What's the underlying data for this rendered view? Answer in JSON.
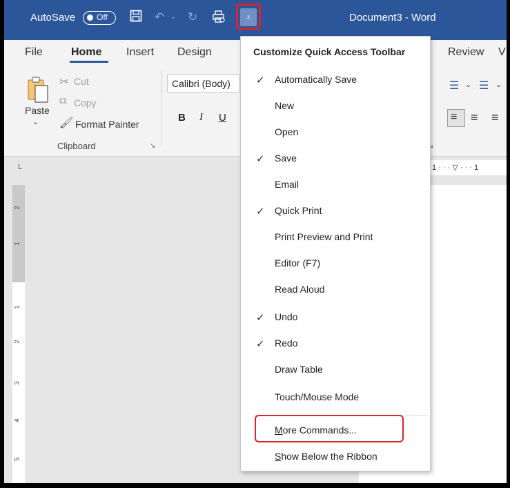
{
  "titlebar": {
    "autosave_label": "AutoSave",
    "autosave_state": "Off",
    "document_title": "Document3  -  Word",
    "colors": {
      "accent": "#2b579a",
      "highlight": "#d9232d"
    }
  },
  "tabs": [
    "File",
    "Home",
    "Insert",
    "Design",
    "Review",
    "V"
  ],
  "ribbon": {
    "paste": "Paste",
    "cut": "Cut",
    "copy": "Copy",
    "format_painter": "Format Painter",
    "clipboard_group": "Clipboard",
    "font_name": "Calibri (Body)",
    "bold": "B",
    "italic": "I",
    "underline": "U"
  },
  "ruler": {
    "corner": "L",
    "horizontal_text": "1 · · · ▽ · · · 1",
    "vertical_ticks": [
      "2",
      "1",
      "1",
      "2",
      "3",
      "4",
      "5"
    ]
  },
  "menu": {
    "title": "Customize Quick Access Toolbar",
    "items": [
      {
        "label": "Automatically Save",
        "checked": "✓"
      },
      {
        "label": "New",
        "checked": ""
      },
      {
        "label": "Open",
        "checked": ""
      },
      {
        "label": "Save",
        "checked": "✓"
      },
      {
        "label": "Email",
        "checked": ""
      },
      {
        "label": "Quick Print",
        "checked": "✓"
      },
      {
        "label": "Print Preview and Print",
        "checked": ""
      },
      {
        "label": "Editor (F7)",
        "checked": ""
      },
      {
        "label": "Read Aloud",
        "checked": ""
      },
      {
        "label": "Undo",
        "checked": "✓"
      },
      {
        "label": "Redo",
        "checked": "✓"
      },
      {
        "label": "Draw Table",
        "checked": ""
      },
      {
        "label": "Touch/Mouse Mode",
        "checked": ""
      }
    ],
    "more_commands": {
      "mnemonic": "M",
      "rest": "ore Commands..."
    },
    "show_below": {
      "mnemonic": "S",
      "rest": "how Below the Ribbon"
    }
  }
}
